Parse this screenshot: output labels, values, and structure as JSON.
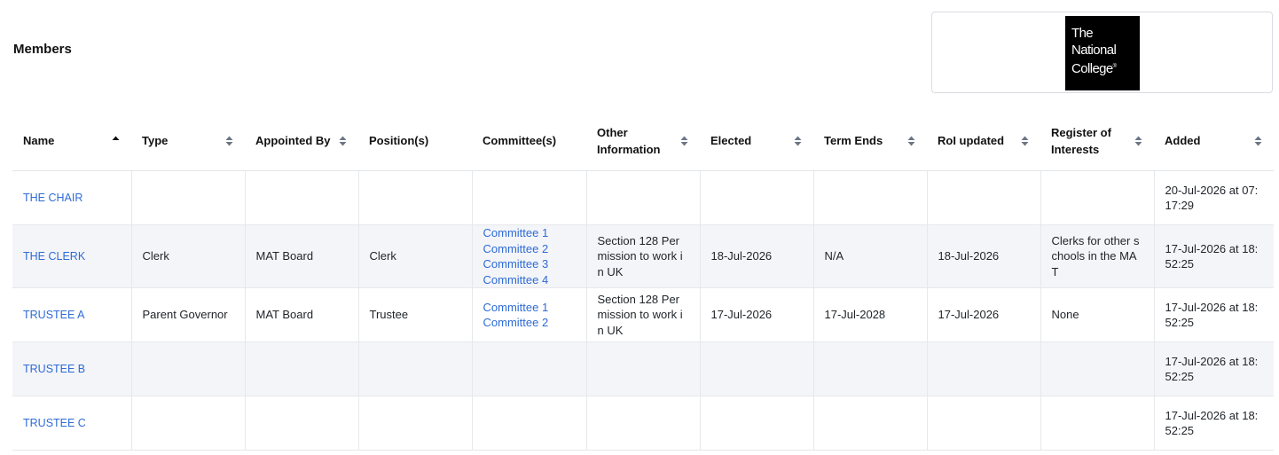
{
  "title": "Members",
  "logo": {
    "lines": [
      "The",
      "National",
      "College"
    ],
    "reg": "®"
  },
  "table": {
    "headers": {
      "name": "Name",
      "type": "Type",
      "appointed_by": "Appointed By",
      "positions": "Position(s)",
      "committees": "Committee(s)",
      "other_info": "Other Information",
      "elected": "Elected",
      "term_ends": "Term Ends",
      "roi_updated": "RoI updated",
      "register": "Register of Interests",
      "added": "Added"
    },
    "sort": {
      "active_column": "name",
      "direction": "ascending",
      "active_color": "#111111",
      "inactive_color": "#6b7585"
    },
    "rows": [
      {
        "name": "THE CHAIR",
        "type": "",
        "appointed_by": "",
        "positions": "",
        "committees": [],
        "other_info": "",
        "elected": "",
        "term_ends": "",
        "roi_updated": "",
        "register": "",
        "added": "20-Jul-2026 at 07:17:29"
      },
      {
        "name": "THE CLERK",
        "type": "Clerk",
        "appointed_by": "MAT Board",
        "positions": "Clerk",
        "committees": [
          "Committee 1",
          "Committee 2",
          "Committee 3",
          "Committee 4"
        ],
        "other_info": "Section 128 Permission to work in UK",
        "elected": "18-Jul-2026",
        "term_ends": "N/A",
        "roi_updated": "18-Jul-2026",
        "register": "Clerks for other schools in the MAT",
        "added": "17-Jul-2026 at 18:52:25"
      },
      {
        "name": "TRUSTEE A",
        "type": "Parent Governor",
        "appointed_by": "MAT Board",
        "positions": "Trustee",
        "committees": [
          "Committee 1",
          "Committee 2"
        ],
        "other_info": "Section 128 Permission to work in UK",
        "elected": "17-Jul-2026",
        "term_ends": "17-Jul-2028",
        "roi_updated": "17-Jul-2026",
        "register": "None",
        "added": "17-Jul-2026 at 18:52:25"
      },
      {
        "name": "TRUSTEE B",
        "type": "",
        "appointed_by": "",
        "positions": "",
        "committees": [],
        "other_info": "",
        "elected": "",
        "term_ends": "",
        "roi_updated": "",
        "register": "",
        "added": "17-Jul-2026 at 18:52:25"
      },
      {
        "name": "TRUSTEE C",
        "type": "",
        "appointed_by": "",
        "positions": "",
        "committees": [],
        "other_info": "",
        "elected": "",
        "term_ends": "",
        "roi_updated": "",
        "register": "",
        "added": "17-Jul-2026 at 18:52:25"
      }
    ]
  },
  "colors": {
    "link": "#2e6bd6",
    "alt_row": "#f4f5f8"
  }
}
